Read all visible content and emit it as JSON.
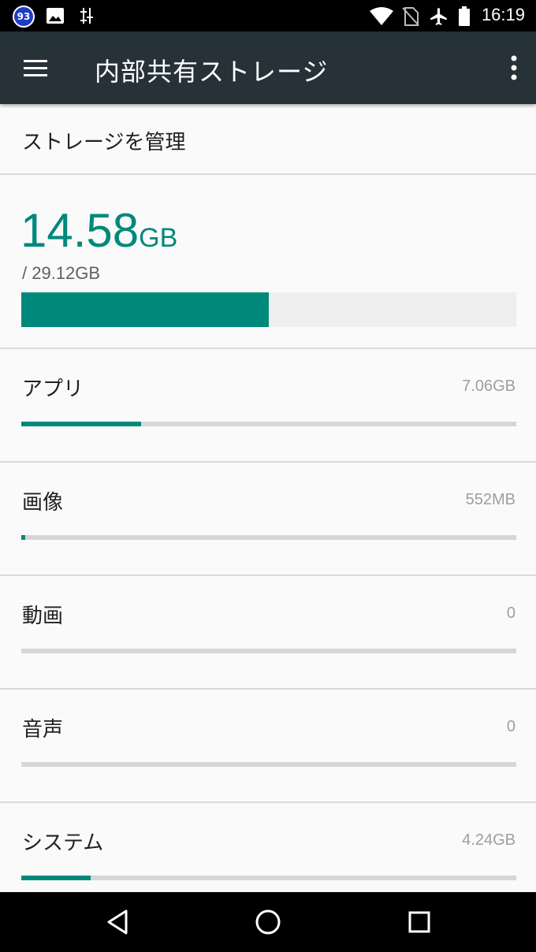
{
  "status_bar": {
    "notification_badge": "93",
    "time": "16:19",
    "icons": [
      "gallery-icon",
      "usb-debug-icon",
      "wifi-icon",
      "no-sim-icon",
      "airplane-icon",
      "battery-icon"
    ]
  },
  "app_bar": {
    "title": "内部共有ストレージ",
    "icons": [
      "menu-icon",
      "more-vert-icon"
    ]
  },
  "manage": {
    "label": "ストレージを管理"
  },
  "summary": {
    "used_value": "14.58",
    "used_unit": "GB",
    "total": "/ 29.12GB",
    "used_fraction": 0.5
  },
  "categories": [
    {
      "label": "アプリ",
      "size": "7.06GB",
      "fraction": 0.242
    },
    {
      "label": "画像",
      "size": "552MB",
      "fraction": 0.008
    },
    {
      "label": "動画",
      "size": "0",
      "fraction": 0
    },
    {
      "label": "音声",
      "size": "0",
      "fraction": 0
    },
    {
      "label": "システム",
      "size": "4.24GB",
      "fraction": 0.14
    }
  ],
  "colors": {
    "accent": "#00897b",
    "app_bar": "#263238",
    "track_light": "#eeeeee",
    "track": "#d6d6d6"
  },
  "nav_bar": {
    "icons": [
      "back-icon",
      "home-icon",
      "recents-icon"
    ]
  }
}
